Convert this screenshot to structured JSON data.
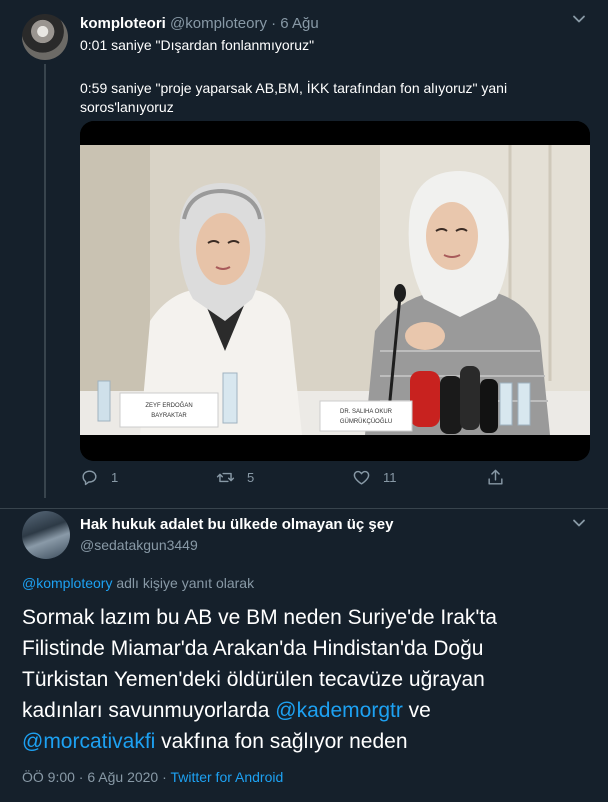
{
  "tweet1": {
    "display_name": "komploteori",
    "handle": "@komploteory",
    "separator": "·",
    "date": "6 Ağu",
    "line1": "0:01 saniye \"Dışardan fonlanmıyoruz\"",
    "line2": "0:59 saniye \"proje yaparsak AB,BM, İKK tarafından fon alıyoruz\" yani",
    "line3": "soros'lanıyoruz",
    "actions": {
      "reply_count": "1",
      "retweet_count": "5",
      "like_count": "11"
    },
    "icons": [
      "chevron-down-icon",
      "reply-icon",
      "retweet-icon",
      "like-icon",
      "share-icon"
    ]
  },
  "tweet2": {
    "display_name": "Hak hukuk adalet bu ülkede olmayan üç şey",
    "handle": "@sedatakgun3449",
    "reply_to_handle": "@komploteory",
    "reply_to_suffix": " adlı kişiye yanıt olarak",
    "body": {
      "line1": "Sormak lazım bu AB ve BM neden Suriye'de Irak'ta",
      "line2": "Filistinde Miamar'da Arakan'da Hindistan'da Doğu",
      "line3": "Türkistan Yemen'deki öldürülen tecavüze uğrayan",
      "line4_text": "kadınları savunmuyorlarda ",
      "line4_mention": "@kademorgtr",
      "line4_after": " ve",
      "line5_mention": "@morcativakfi",
      "line5_after": " vakfına fon sağlıyor neden"
    },
    "time": "ÖÖ 9:00",
    "separator": " · ",
    "date": "6 Ağu 2020",
    "source": "Twitter for Android"
  },
  "video": {
    "nameplate_left_line1": "ZEYF ERDOĞAN",
    "nameplate_left_line2": "BAYRAKTAR",
    "nameplate_right_line1": "DR. SALIHA OKUR",
    "nameplate_right_line2": "GÜMRÜKÇÜOĞLU"
  },
  "colors": {
    "background": "#15202b",
    "muted": "#8899a6",
    "link": "#1da1f2",
    "divider": "#38444d"
  }
}
